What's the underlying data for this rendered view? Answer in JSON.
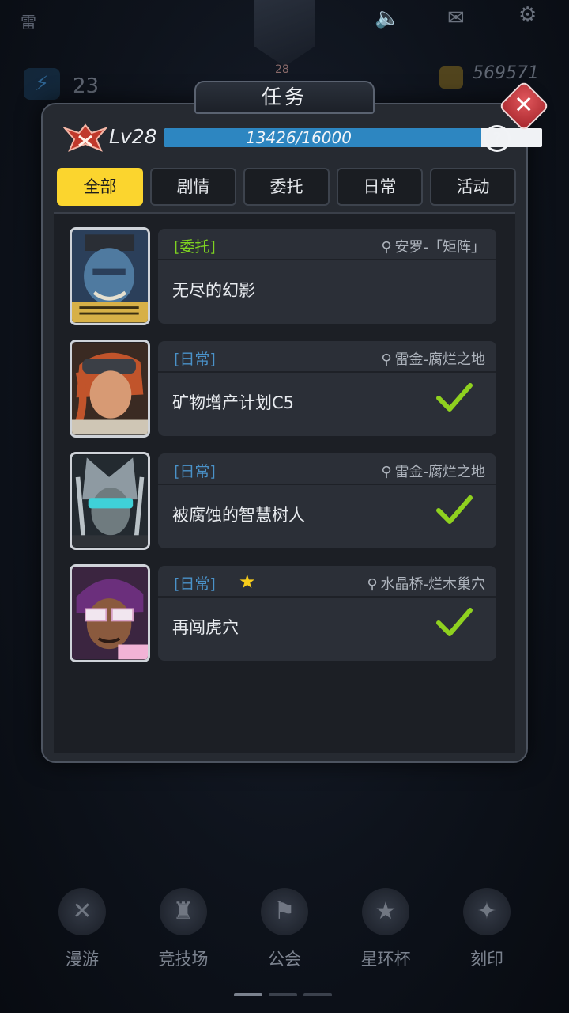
{
  "hud": {
    "corner_text": "雷",
    "avatar_level": "28",
    "energy": "23",
    "coins": "569571"
  },
  "dialog": {
    "title": "任务",
    "level_label": "Lv28",
    "xp_text": "13426/16000",
    "xp_progress": 0.839,
    "help_label": "?"
  },
  "tabs": [
    {
      "label": "全部",
      "active": true
    },
    {
      "label": "剧情",
      "active": false
    },
    {
      "label": "委托",
      "active": false
    },
    {
      "label": "日常",
      "active": false
    },
    {
      "label": "活动",
      "active": false
    }
  ],
  "tasks": [
    {
      "tag": "[委托]",
      "type": "commission",
      "location": "安罗-「矩阵」",
      "name": "无尽的幻影",
      "completed": false,
      "starred": false
    },
    {
      "tag": "[日常]",
      "type": "daily",
      "location": "雷金-腐烂之地",
      "name": "矿物增产计划C5",
      "completed": true,
      "starred": false
    },
    {
      "tag": "[日常]",
      "type": "daily",
      "location": "雷金-腐烂之地",
      "name": "被腐蚀的智慧树人",
      "completed": true,
      "starred": false
    },
    {
      "tag": "[日常]",
      "type": "daily",
      "location": "水晶桥-烂木巢穴",
      "name": "再闯虎穴",
      "completed": true,
      "starred": true
    }
  ],
  "bottom_nav": [
    {
      "label": "漫游",
      "icon": "roam-icon"
    },
    {
      "label": "竞技场",
      "icon": "arena-icon"
    },
    {
      "label": "公会",
      "icon": "guild-banner-icon"
    },
    {
      "label": "星环杯",
      "icon": "trophy-icon"
    },
    {
      "label": "刻印",
      "icon": "compass-star-icon"
    }
  ],
  "colors": {
    "accent_yellow": "#fbd52e",
    "xp_blue": "#2d86c1",
    "commission_green": "#7ed321",
    "daily_blue": "#4a92c9",
    "check_green": "#8fd11f",
    "close_red": "#c8343a"
  }
}
